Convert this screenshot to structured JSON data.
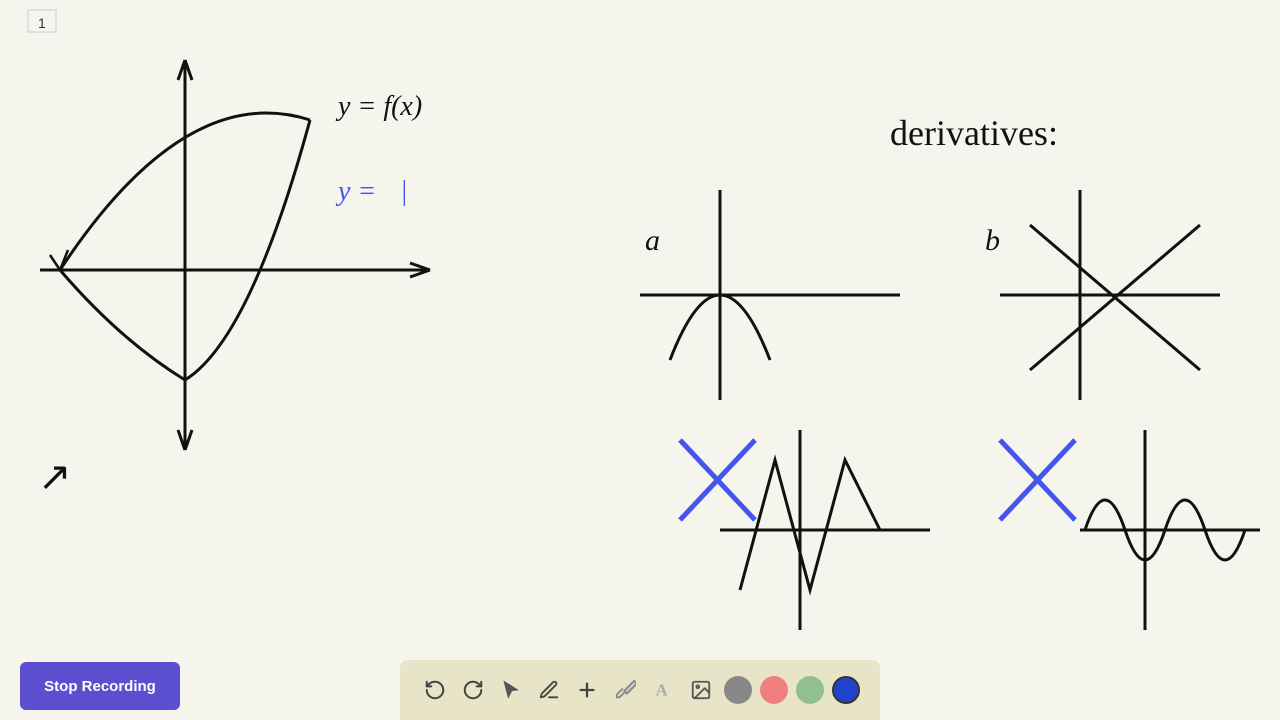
{
  "toolbar": {
    "stop_recording_label": "Stop Recording",
    "tools": [
      {
        "name": "undo",
        "symbol": "↺",
        "label": "Undo"
      },
      {
        "name": "redo",
        "symbol": "↻",
        "label": "Redo"
      },
      {
        "name": "select",
        "symbol": "▲",
        "label": "Select"
      },
      {
        "name": "pen",
        "symbol": "✏",
        "label": "Pen"
      },
      {
        "name": "add",
        "symbol": "+",
        "label": "Add"
      },
      {
        "name": "highlighter",
        "symbol": "⬌",
        "label": "Highlighter"
      },
      {
        "name": "text",
        "symbol": "A",
        "label": "Text"
      },
      {
        "name": "image",
        "symbol": "🖼",
        "label": "Image"
      }
    ],
    "colors": [
      {
        "name": "gray",
        "value": "#888888",
        "active": false
      },
      {
        "name": "pink",
        "value": "#f08080",
        "active": false
      },
      {
        "name": "green",
        "value": "#90c090",
        "active": false
      },
      {
        "name": "blue",
        "value": "#2244cc",
        "active": true
      }
    ]
  },
  "canvas": {
    "background": "#f5f5ee"
  }
}
